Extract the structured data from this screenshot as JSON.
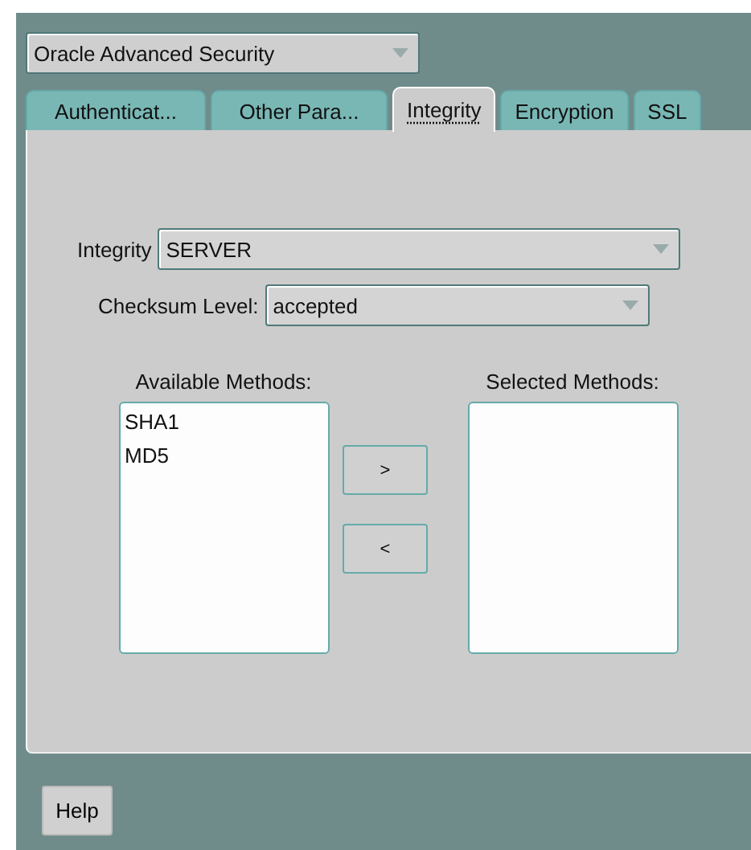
{
  "product_select": {
    "value": "Oracle Advanced Security"
  },
  "tabs": [
    {
      "label": "Authenticat...",
      "selected": false
    },
    {
      "label": "Other Para...",
      "selected": false
    },
    {
      "label": "Integrity",
      "selected": true
    },
    {
      "label": "Encryption",
      "selected": false
    },
    {
      "label": "SSL",
      "selected": false
    }
  ],
  "integrity": {
    "label": "Integrity",
    "value": "SERVER"
  },
  "checksum_level": {
    "label": "Checksum Level:",
    "value": "accepted"
  },
  "available_methods": {
    "label": "Available Methods:",
    "items": [
      "SHA1",
      "MD5"
    ]
  },
  "selected_methods": {
    "label": "Selected Methods:"
  },
  "move_buttons": [
    ">",
    "<"
  ],
  "help_button": "Help"
}
